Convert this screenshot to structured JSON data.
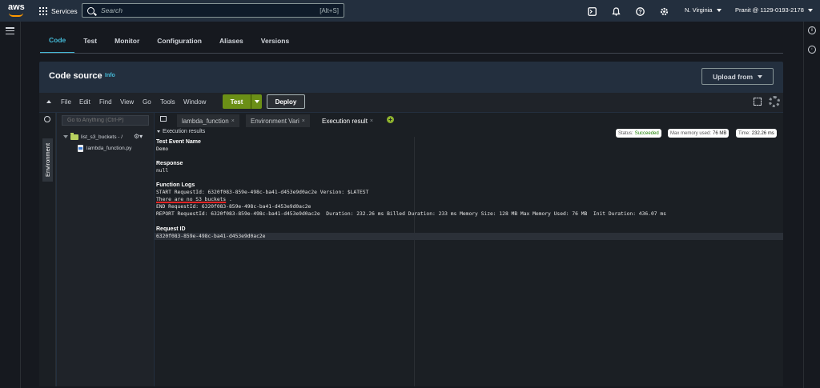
{
  "topnav": {
    "logo_text": "aws",
    "services_label": "Services",
    "search_placeholder": "Search",
    "search_shortcut": "[Alt+S]",
    "region": "N. Virginia",
    "account": "Pranit @ 1129-0193-2178"
  },
  "tabs": [
    "Code",
    "Test",
    "Monitor",
    "Configuration",
    "Aliases",
    "Versions"
  ],
  "panel": {
    "title": "Code source",
    "info": "Info",
    "upload_label": "Upload from"
  },
  "ide_menu": [
    "File",
    "Edit",
    "Find",
    "View",
    "Go",
    "Tools",
    "Window"
  ],
  "ide_buttons": {
    "test": "Test",
    "deploy": "Deploy"
  },
  "environment": {
    "label": "Environment",
    "goto_placeholder": "Go to Anything (Ctrl-P)",
    "folder": "list_s3_buckets - /",
    "file": "lambda_function.py"
  },
  "editor_tabs": [
    {
      "label": "lambda_function",
      "active": false
    },
    {
      "label": "Environment Vari",
      "active": false
    },
    {
      "label": "Execution result",
      "active": true
    }
  ],
  "result": {
    "header": "Execution results",
    "status_label": "Status:",
    "status_value": "Succeeded",
    "memory_label": "Max memory used:",
    "memory_value": "76 MB",
    "time_label": "Time:",
    "time_value": "232.26 ms",
    "test_event_heading": "Test Event Name",
    "test_event_value": "Demo",
    "response_heading": "Response",
    "response_value": "null",
    "logs_heading": "Function Logs",
    "log_start": "START RequestId: 6320f083-859e-498c-ba41-d453e9d0ac2e Version: $LATEST",
    "log_message": "There are no S3 buckets",
    "log_message_tail": " .",
    "log_end": "END RequestId: 6320f083-859e-498c-ba41-d453e9d0ac2e",
    "log_report": "REPORT RequestId: 6320f083-859e-498c-ba41-d453e9d0ac2e  Duration: 232.26 ms Billed Duration: 233 ms Memory Size: 128 MB Max Memory Used: 76 MB  Init Duration: 436.07 ms",
    "request_heading": "Request ID",
    "request_value": "6320f083-859e-498c-ba41-d453e9d0ac2e"
  },
  "colors": {
    "accent": "#44b9d6",
    "test_button": "#6b8f16",
    "success": "#1d8102",
    "nav_bg": "#232f3e"
  }
}
